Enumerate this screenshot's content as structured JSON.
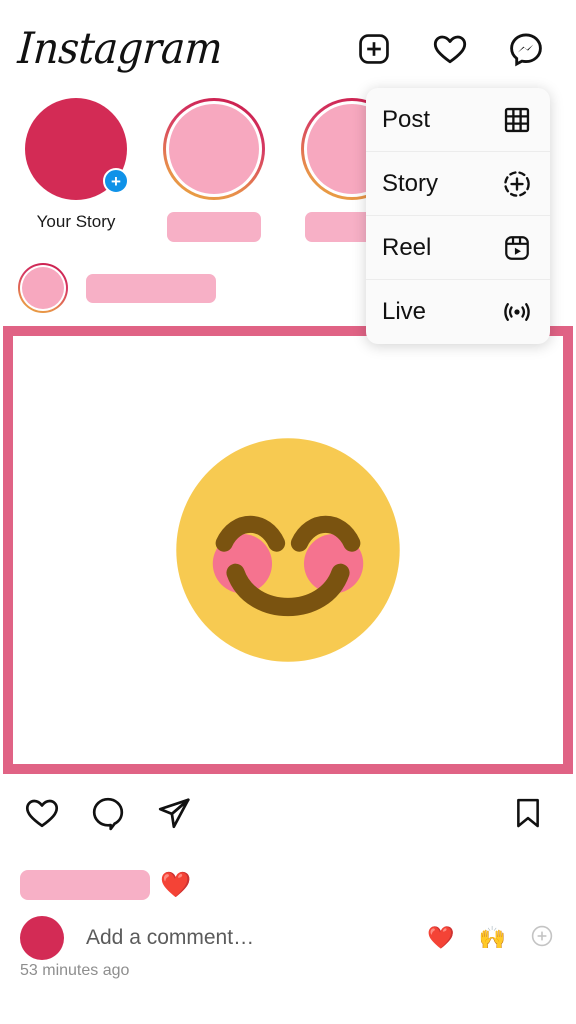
{
  "header": {
    "logo": "Instagram",
    "icons": [
      {
        "name": "new-post-icon",
        "glyph": "plus-square"
      },
      {
        "name": "activity-heart-icon",
        "glyph": "heart"
      },
      {
        "name": "messenger-icon",
        "glyph": "messenger"
      }
    ]
  },
  "create_menu": {
    "items": [
      {
        "label": "Post",
        "icon": "grid-icon"
      },
      {
        "label": "Story",
        "icon": "story-plus-icon"
      },
      {
        "label": "Reel",
        "icon": "reel-icon"
      },
      {
        "label": "Live",
        "icon": "live-broadcast-icon"
      }
    ]
  },
  "stories": {
    "your_story_label": "Your Story",
    "add_badge": "+",
    "items": [
      {
        "type": "self",
        "label": "Your Story"
      },
      {
        "type": "user",
        "label": ""
      },
      {
        "type": "user",
        "label": ""
      },
      {
        "type": "user",
        "label": ""
      }
    ]
  },
  "post": {
    "image_emoji": "smiling-face-with-smiling-eyes-and-blush",
    "actions": {
      "like": "like-icon",
      "comment": "comment-icon",
      "share": "share-icon",
      "save": "save-icon"
    },
    "caption_emoji": "❤️",
    "timestamp": "53 minutes ago"
  },
  "comment_box": {
    "placeholder": "Add a comment…",
    "quick_emojis": [
      "❤️",
      "🙌"
    ],
    "more_label": "+"
  },
  "colors": {
    "crimson": "#d32b55",
    "pink": "#f7b0c6",
    "border_pink": "#e06385",
    "badge_blue": "#0f92e8",
    "emoji_yellow": "#f7ca51",
    "emoji_brown": "#7a5310",
    "emoji_blush": "#f5738f"
  }
}
